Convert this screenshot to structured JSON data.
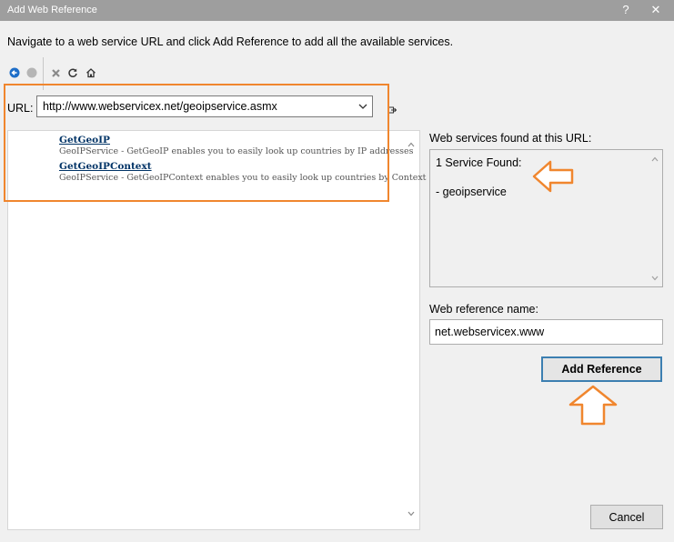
{
  "window": {
    "title": "Add Web Reference",
    "help_glyph": "?",
    "close_glyph": "✕"
  },
  "instruction": "Navigate to a web service URL and click Add Reference to add all the available services.",
  "toolbar": {
    "icons": [
      "back-icon",
      "forward-icon",
      "stop-icon",
      "refresh-icon",
      "home-icon"
    ]
  },
  "url": {
    "label": "URL:",
    "value": "http://www.webservicex.net/geoipservice.asmx"
  },
  "browser": {
    "operations": [
      {
        "name": "GetGeoIP",
        "description": "GeoIPService - GetGeoIP enables you to easily look up countries by IP addresses"
      },
      {
        "name": "GetGeoIPContext",
        "description": "GeoIPService - GetGeoIPContext enables you to easily look up countries by Context"
      }
    ]
  },
  "services_panel": {
    "label": "Web services found at this URL:",
    "count_text": "1 Service Found:",
    "service_item": "- geoipservice"
  },
  "reference_name": {
    "label": "Web reference name:",
    "value": "net.webservicex.www"
  },
  "buttons": {
    "add_reference": "Add Reference",
    "cancel": "Cancel"
  },
  "colors": {
    "accent_orange": "#f0862e",
    "title_bar": "#9e9e9e",
    "default_button_border": "#3c7fb1",
    "link": "#003366"
  }
}
